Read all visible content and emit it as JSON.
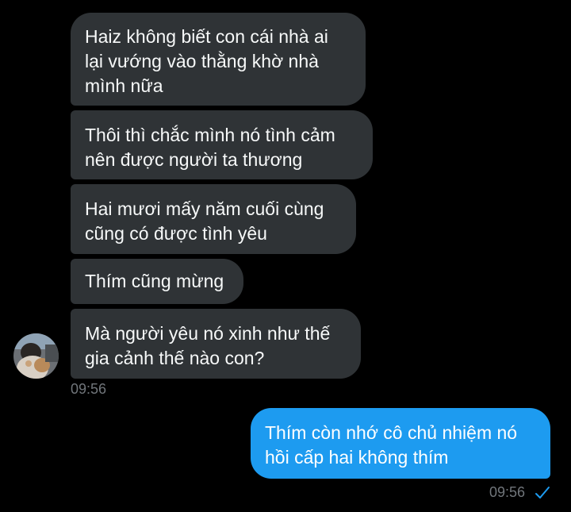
{
  "messages": {
    "incoming": [
      {
        "text": "Haiz không biết con cái nhà ai\nlại vướng vào thằng khờ nhà\nmình nữa"
      },
      {
        "text": "Thôi thì chắc mình nó tình cảm\nnên được người ta thương"
      },
      {
        "text": "Hai mươi mấy năm cuối cùng\ncũng có được tình yêu"
      },
      {
        "text": "Thím cũng mừng"
      },
      {
        "text": "Mà người yêu nó xinh như thế\ngia cảnh thế nào con?"
      }
    ],
    "incoming_time": "09:56",
    "outgoing": [
      {
        "text": "Thím còn nhớ cô chủ nhiệm nó\nhồi cấp hai không thím"
      }
    ],
    "outgoing_time": "09:56"
  },
  "icons": {
    "read_receipt": "check-icon",
    "avatar": "avatar"
  },
  "colors": {
    "incoming_bubble": "#2f3336",
    "outgoing_bubble": "#1d9bf0",
    "timestamp": "#71767b",
    "background": "#000000"
  }
}
